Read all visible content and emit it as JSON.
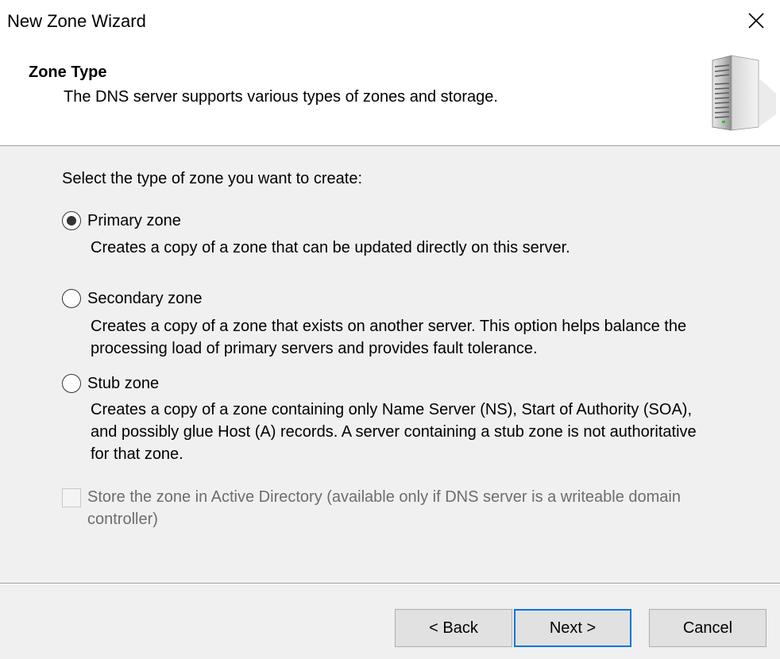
{
  "window": {
    "title": "New Zone Wizard",
    "close_icon": "close-icon"
  },
  "header": {
    "title": "Zone Type",
    "subtitle": "The DNS server supports various types of zones and storage.",
    "icon": "server-icon"
  },
  "body": {
    "prompt": "Select the type of zone you want to create:",
    "options": [
      {
        "label": "Primary zone",
        "selected": true,
        "description": "Creates a copy of a zone that can be updated directly on this server."
      },
      {
        "label": "Secondary zone",
        "selected": false,
        "description": "Creates a copy of a zone that exists on another server. This option helps balance the processing load of primary servers and provides fault tolerance."
      },
      {
        "label": "Stub zone",
        "selected": false,
        "description": "Creates a copy of a zone containing only Name Server (NS), Start of Authority (SOA), and possibly glue Host (A) records. A server containing a stub zone is not authoritative for that zone."
      }
    ],
    "store_ad": {
      "label": "Store the zone in Active Directory (available only if DNS server is a writeable domain controller)",
      "checked": false,
      "enabled": false
    }
  },
  "buttons": {
    "back": "< Back",
    "next": "Next >",
    "cancel": "Cancel"
  },
  "colors": {
    "default_button_border": "#0078d7",
    "disabled_text": "#6d6d6d"
  }
}
